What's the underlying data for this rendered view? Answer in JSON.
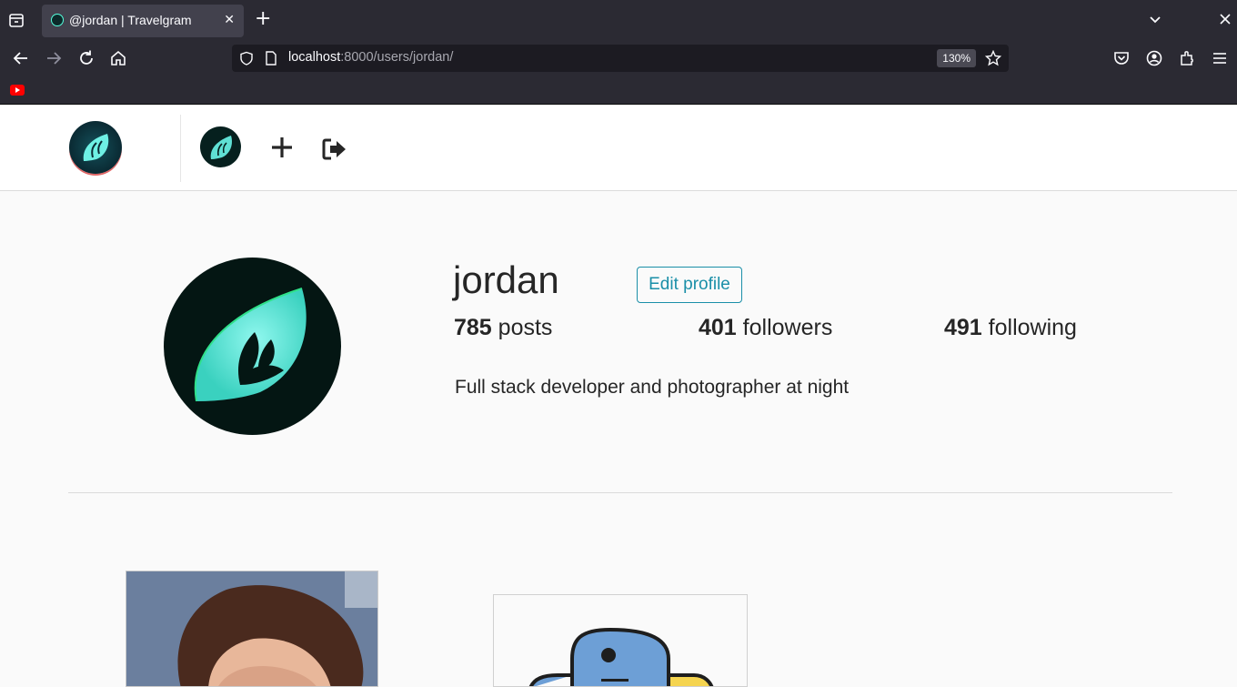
{
  "browser": {
    "tab_title": "@jordan | Travelgram",
    "tab_close": "✕",
    "new_tab": "+",
    "url_host": "localhost",
    "url_path": ":8000/users/jordan/",
    "zoom": "130%"
  },
  "header": {
    "brand_icon": "travelgram-logo-icon",
    "avatar_icon": "user-avatar-icon",
    "new_post_icon": "plus-icon",
    "logout_icon": "logout-icon"
  },
  "profile": {
    "username": "jordan",
    "edit_label": "Edit profile",
    "posts_count": "785",
    "posts_label": "posts",
    "followers_count": "401",
    "followers_label": "followers",
    "following_count": "491",
    "following_label": "following",
    "bio": "Full stack developer and photographer at night"
  },
  "colors": {
    "accent": "#1a8fa8",
    "chrome": "#2b2a33"
  }
}
